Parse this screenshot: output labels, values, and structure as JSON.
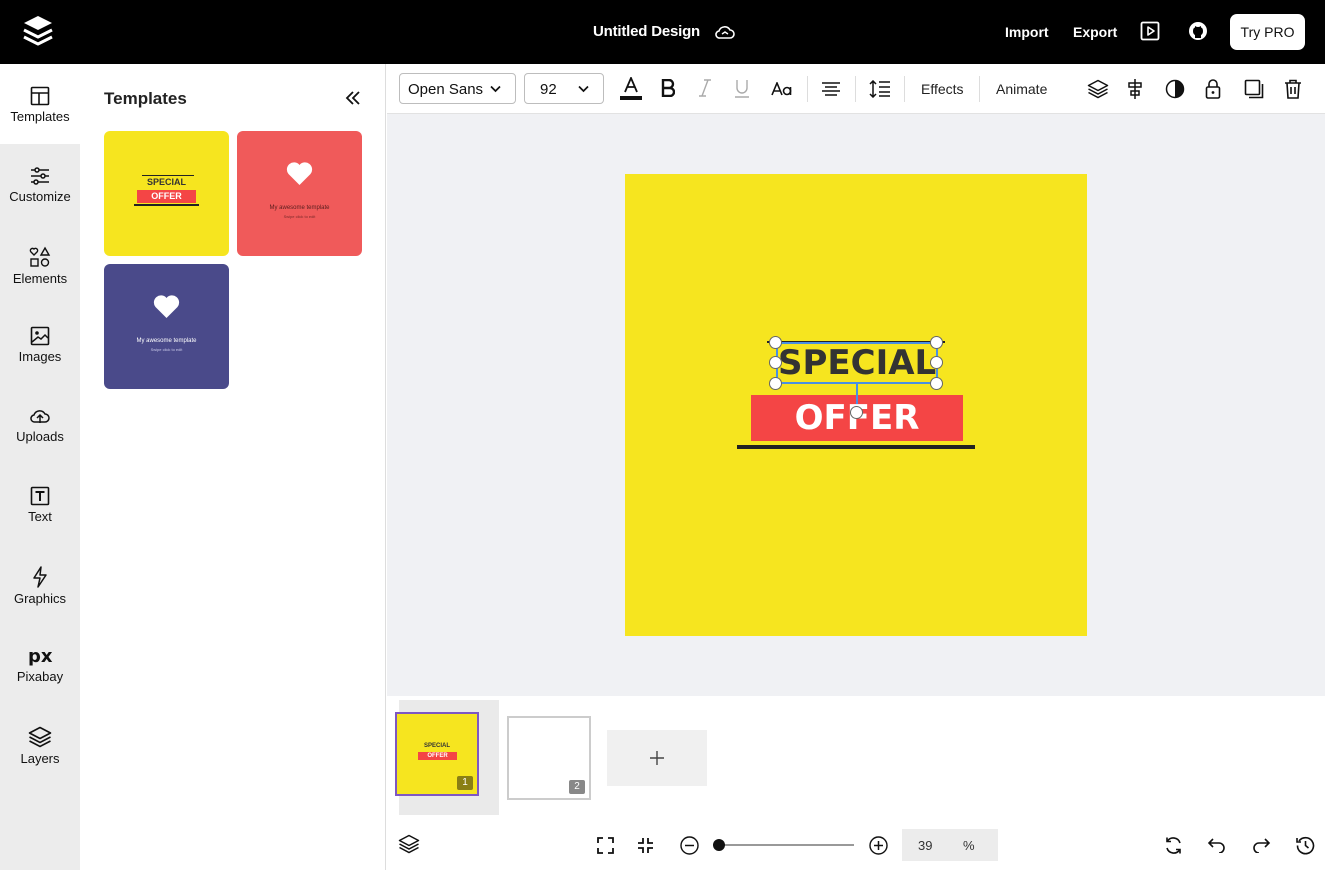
{
  "topbar": {
    "logo_icon": "layers-logo-icon",
    "doc_title": "Untitled Design",
    "cloud_icon": "cloud-sync-icon",
    "import_label": "Import",
    "export_label": "Export",
    "preview_icon": "play-preview-icon",
    "github_icon": "github-icon",
    "try_pro_label": "Try PRO"
  },
  "sidebar": {
    "items": [
      {
        "label": "Templates",
        "icon": "templates-icon"
      },
      {
        "label": "Customize",
        "icon": "sliders-icon"
      },
      {
        "label": "Elements",
        "icon": "shapes-icon"
      },
      {
        "label": "Images",
        "icon": "image-icon"
      },
      {
        "label": "Uploads",
        "icon": "cloud-upload-icon"
      },
      {
        "label": "Text",
        "icon": "text-icon"
      },
      {
        "label": "Graphics",
        "icon": "lightning-icon"
      },
      {
        "label": "Pixabay",
        "icon": "pixabay-icon"
      },
      {
        "label": "Layers",
        "icon": "layers-icon"
      }
    ]
  },
  "panel": {
    "title": "Templates",
    "templates": [
      {
        "top_text": "SPECIAL",
        "bottom_text": "OFFER",
        "color": "#f6e51f"
      },
      {
        "line1": "My awesome template",
        "line2": "Swipe click to edit",
        "color": "#f05a5a"
      },
      {
        "line1": "My awesome template",
        "line2": "Swipe click to edit",
        "color": "#4a4a8a"
      }
    ]
  },
  "toolbar": {
    "font_family": "Open Sans",
    "font_size": "92",
    "effects_label": "Effects",
    "animate_label": "Animate",
    "text_color": "#000000"
  },
  "canvas": {
    "background": "#f6e51f",
    "special_text": "SPECIAL",
    "offer_text": "OFFER",
    "offer_bg": "#f44545"
  },
  "pages": {
    "items": [
      {
        "number": "1",
        "thumb_special": "SPECIAL",
        "thumb_offer": "OFFER"
      },
      {
        "number": "2"
      }
    ]
  },
  "zoom": {
    "value": "39",
    "unit": "%",
    "level_percent": 39
  }
}
